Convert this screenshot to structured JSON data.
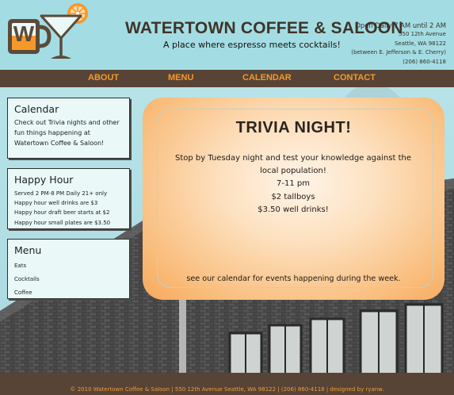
{
  "header": {
    "title": "WATERTOWN COFFEE & SALOON",
    "tagline": "A place where espresso meets cocktails!",
    "logo_letter": "W",
    "contact": {
      "hours": "Open Daily 7 AM until 2 AM",
      "street": "550 12th Avenue",
      "city": "Seattle, WA 98122",
      "cross_streets": "(between E. Jefferson & E. Cherry)",
      "phone": "(206) 860-4118"
    }
  },
  "nav": {
    "items": [
      {
        "label": "ABOUT"
      },
      {
        "label": "MENU"
      },
      {
        "label": "CALENDAR"
      },
      {
        "label": "CONTACT"
      }
    ]
  },
  "sidebar": {
    "calendar": {
      "heading": "Calendar",
      "text": "Check out Trivia nights and other fun things happening at Watertown Coffee & Saloon!"
    },
    "happy_hour": {
      "heading": "Happy Hour",
      "items": [
        "Served 2 PM-8 PM Daily 21+ only",
        "Happy hour well drinks are $3",
        "Happy hour draft beer starts at $2",
        "Happy hour small plates are $3.50"
      ]
    },
    "menu": {
      "heading": "Menu",
      "items": [
        "Eats",
        "Cocktails",
        "Coffee"
      ]
    }
  },
  "feature": {
    "title": "TRIVIA NIGHT!",
    "lines": [
      "Stop by Tuesday night and test your knowledge against the",
      "local population!",
      "7-11 pm",
      "$2 tallboys",
      "$3.50 well drinks!"
    ],
    "footer": "see our calendar for events happening during the week."
  },
  "footer": {
    "text": "© 2010 Watertown Coffee & Saloon | 550 12th Avenue Seattle, WA 98122 | (206) 860-4118 | designed by ryanw."
  },
  "colors": {
    "header_bg": "#a3dde3",
    "nav_bg": "#574436",
    "nav_text": "#f5982a",
    "accent_orange": "#f7a85c",
    "footer_text": "#f29a3a"
  },
  "icons": [
    "cocktail-glass-logo-icon",
    "orange-slice-icon"
  ]
}
